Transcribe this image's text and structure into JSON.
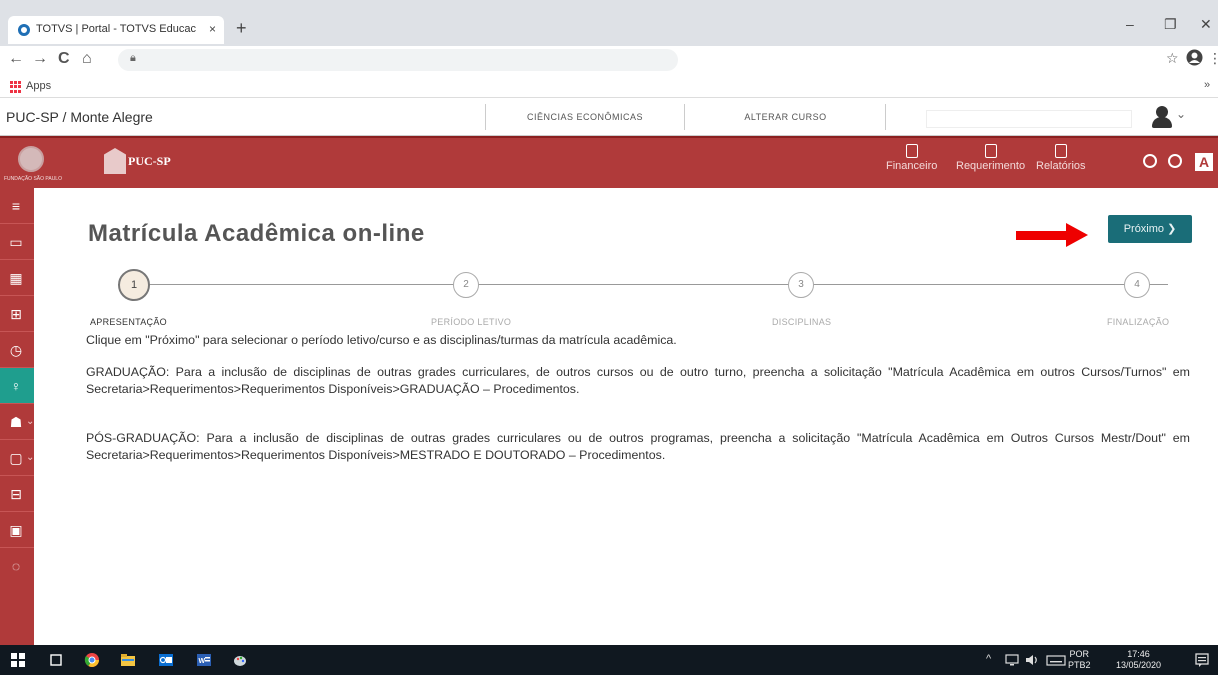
{
  "browser": {
    "tab_title": "TOTVS | Portal - TOTVS Educacional",
    "tab_close": "×",
    "new_tab": "+",
    "bookmarks_apps": "Apps",
    "bookmarks_more": "»",
    "min": "–",
    "max": "❐",
    "close": "✕",
    "back": "←",
    "forward": "→",
    "reload": "C",
    "home": "⌂",
    "star": "☆",
    "menu": "⋮"
  },
  "header": {
    "institution": "PUC-SP / Monte Alegre",
    "course": "CIÊNCIAS ECONÔMICAS",
    "change_course": "ALTERAR CURSO"
  },
  "brand": {
    "fund_text": "FUNDAÇÃO SÃO PAULO",
    "puc_text": "PUC-SP",
    "color": "#b03a3a"
  },
  "topmenu": [
    {
      "label": "Financeiro"
    },
    {
      "label": "Requerimento"
    },
    {
      "label": "Relatórios"
    }
  ],
  "font_toggle": "A",
  "sidebar": {
    "items": [
      {
        "icon": "menu-icon",
        "glyph": "≡"
      },
      {
        "icon": "monitor-icon",
        "glyph": "▭"
      },
      {
        "icon": "calendar-icon",
        "glyph": "▦"
      },
      {
        "icon": "grid-icon",
        "glyph": "⊞"
      },
      {
        "icon": "clock-icon",
        "glyph": "◷"
      },
      {
        "icon": "user-add-icon",
        "glyph": "♀"
      },
      {
        "icon": "graduation-icon",
        "glyph": "☗",
        "chev": "⌄"
      },
      {
        "icon": "clipboard-icon",
        "glyph": "▢",
        "chev": "⌄"
      },
      {
        "icon": "inbox-icon",
        "glyph": "⊟"
      },
      {
        "icon": "money-icon",
        "glyph": "▣"
      },
      {
        "icon": "more-icon",
        "glyph": "◌"
      }
    ]
  },
  "main": {
    "title": "Matrícula Acadêmica on-line",
    "next_button": "Próximo ❯",
    "steps": [
      {
        "num": "1",
        "label": "APRESENTAÇÃO"
      },
      {
        "num": "2",
        "label": "PERÍODO LETIVO"
      },
      {
        "num": "3",
        "label": "DISCIPLINAS"
      },
      {
        "num": "4",
        "label": "FINALIZAÇÃO"
      }
    ],
    "paragraphs": [
      "Clique em \"Próximo\" para selecionar o período letivo/curso e as disciplinas/turmas da matrícula acadêmica.",
      "GRADUAÇÃO: Para a inclusão de disciplinas de outras grades curriculares, de outros cursos ou de outro turno, preencha a solicitação \"Matrícula Acadêmica em outros Cursos/Turnos\" em Secretaria>Requerimentos>Requerimentos Disponíveis>GRADUAÇÃO – Procedimentos.",
      "PÓS-GRADUAÇÃO: Para a inclusão de disciplinas de outras grades curriculares ou de outros programas, preencha a solicitação \"Matrícula Acadêmica em Outros Cursos Mestr/Dout\" em Secretaria>Requerimentos>Requerimentos Disponíveis>MESTRADO E DOUTORADO – Procedimentos."
    ]
  },
  "taskbar": {
    "lang1": "POR",
    "lang2": "PTB2",
    "time": "17:46",
    "date": "13/05/2020"
  }
}
